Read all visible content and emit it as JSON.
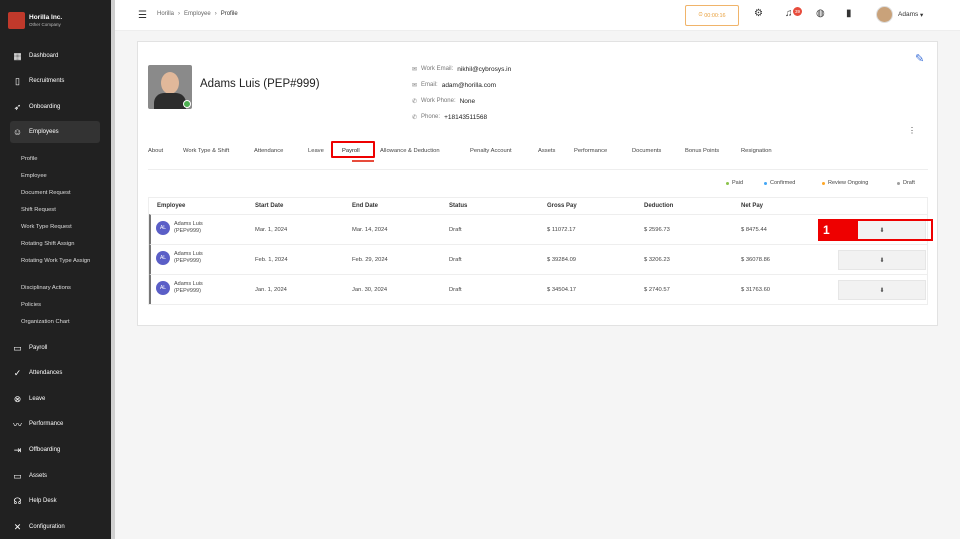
{
  "brand": {
    "name": "Horilla Inc.",
    "sub": "Other Company"
  },
  "sidebar": {
    "items": [
      {
        "label": "Dashboard",
        "icon": "grid-icon"
      },
      {
        "label": "Recruitments",
        "icon": "clipboard-icon"
      },
      {
        "label": "Onboarding",
        "icon": "rocket-icon"
      },
      {
        "label": "Employees",
        "icon": "people-icon"
      },
      {
        "label": "Payroll",
        "icon": "wallet-icon"
      },
      {
        "label": "Attendances",
        "icon": "check-circle-icon"
      },
      {
        "label": "Leave",
        "icon": "x-circle-icon"
      },
      {
        "label": "Performance",
        "icon": "trend-icon"
      },
      {
        "label": "Offboarding",
        "icon": "exit-icon"
      },
      {
        "label": "Assets",
        "icon": "monitor-icon"
      },
      {
        "label": "Help Desk",
        "icon": "headset-icon"
      },
      {
        "label": "Configuration",
        "icon": "tools-icon"
      }
    ],
    "subitems": [
      "Profile",
      "Employee",
      "Document Request",
      "Shift Request",
      "Work Type Request",
      "Rotating Shift Assign",
      "Rotating Work Type Assign",
      "Disciplinary Actions",
      "Policies",
      "Organization Chart"
    ]
  },
  "topbar": {
    "breadcrumb": [
      "Horilla",
      "Employee",
      "Profile"
    ],
    "clock": "00:00:16",
    "notif_count": "39",
    "user": "Adams"
  },
  "profile": {
    "name": "Adams Luis (PEP#999)",
    "work_email_label": "Work Email:",
    "work_email": "nikhil@cybrosys.in",
    "email_label": "Email:",
    "email": "adam@horilla.com",
    "work_phone_label": "Work Phone:",
    "work_phone": "None",
    "phone_label": "Phone:",
    "phone": "+18143511568"
  },
  "tabs": [
    "About",
    "Work Type & Shift",
    "Attendance",
    "Leave",
    "Payroll",
    "Allowance & Deduction",
    "Penalty Account",
    "Assets",
    "Performance",
    "Documents",
    "Bonus Points",
    "Resignation"
  ],
  "legend": [
    {
      "label": "Paid",
      "color": "#8bc34a"
    },
    {
      "label": "Confirmed",
      "color": "#42a5f5"
    },
    {
      "label": "Review Ongoing",
      "color": "#ffa726"
    },
    {
      "label": "Draft",
      "color": "#9e9e9e"
    }
  ],
  "table": {
    "headers": [
      "Employee",
      "Start Date",
      "End Date",
      "Status",
      "Gross Pay",
      "Deduction",
      "Net Pay"
    ],
    "rows": [
      {
        "initials": "AL",
        "name1": "Adams Luis",
        "name2": "(PEP#999)",
        "start": "Mar. 1, 2024",
        "end": "Mar. 14, 2024",
        "status": "Draft",
        "gross": "$ 11072.17",
        "deduction": "$ 2596.73",
        "net": "$ 8475.44"
      },
      {
        "initials": "AL",
        "name1": "Adams Luis",
        "name2": "(PEP#999)",
        "start": "Feb. 1, 2024",
        "end": "Feb. 29, 2024",
        "status": "Draft",
        "gross": "$ 39284.09",
        "deduction": "$ 3206.23",
        "net": "$ 36078.86"
      },
      {
        "initials": "AL",
        "name1": "Adams Luis",
        "name2": "(PEP#999)",
        "start": "Jan. 1, 2024",
        "end": "Jan. 30, 2024",
        "status": "Draft",
        "gross": "$ 34504.17",
        "deduction": "$ 2740.57",
        "net": "$ 31763.60"
      }
    ]
  },
  "annotation": {
    "badge": "1"
  }
}
